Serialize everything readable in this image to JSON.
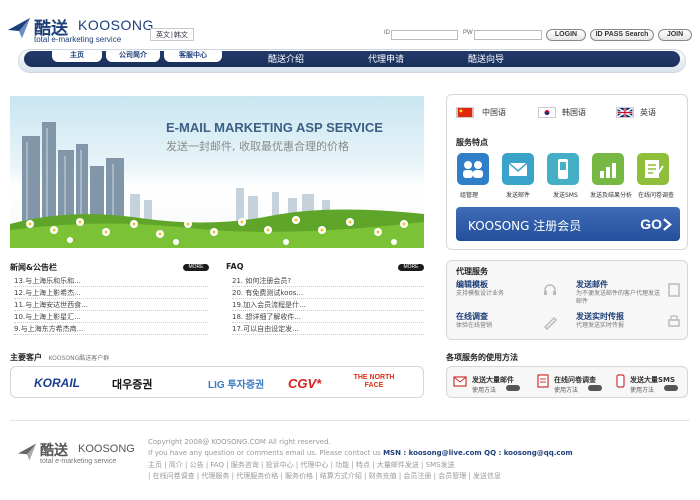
{
  "header": {
    "logo": {
      "cn": "酷送",
      "en": "KOOSONG",
      "tagline": "total e-marketing service"
    },
    "lang_links": [
      "英文",
      "韩文"
    ],
    "login": {
      "id_label": "ID",
      "pw_label": "PW",
      "login_button": "LOGIN",
      "idpass_button": "ID PASS Search",
      "join_button": "JOIN"
    }
  },
  "nav": {
    "sub_items": [
      "主页",
      "公司简介",
      "客服中心"
    ],
    "main_items": [
      "酷送介绍",
      "代理申请",
      "酷送向导"
    ]
  },
  "banner": {
    "title": "E-MAIL MARKETING ASP SERVICE",
    "subtitle": "发送一封邮件, 收取最优惠合理的价格"
  },
  "languages": [
    {
      "label": "中国语",
      "flag": "china-flag-icon"
    },
    {
      "label": "韩国语",
      "flag": "korea-flag-icon"
    },
    {
      "label": "英语",
      "flag": "uk-flag-icon"
    }
  ],
  "features": {
    "title": "服务特点",
    "items": [
      {
        "label": "组管理",
        "icon": "group-icon",
        "color": "#2f7fc8"
      },
      {
        "label": "发送邮件",
        "icon": "mail-icon",
        "color": "#3aa3c9"
      },
      {
        "label": "发送SMS",
        "icon": "phone-icon",
        "color": "#45b0c5"
      },
      {
        "label": "发送及结果分析",
        "icon": "chart-icon",
        "color": "#76b843"
      },
      {
        "label": "在线问卷调查",
        "icon": "survey-icon",
        "color": "#8fbe3a"
      }
    ]
  },
  "register": {
    "label": "KOOSONG 注册会员",
    "go": "GO"
  },
  "agent_services": {
    "title": "代理服务",
    "items": [
      {
        "title": "编辑模板",
        "desc": "支持模板设计业务"
      },
      {
        "title": "发送邮件",
        "desc": "为不便发送邮件的客户代理发送邮件"
      },
      {
        "title": "在线调查",
        "desc": "体验在线营销"
      },
      {
        "title": "发送实时传报",
        "desc": "代理发送实时传报"
      }
    ]
  },
  "usage": {
    "title": "各项服务的使用方法",
    "items": [
      {
        "title": "发送大量邮件",
        "sub": "使用方法"
      },
      {
        "title": "在线问卷调查",
        "sub": "使用方法"
      },
      {
        "title": "发送大量SMS",
        "sub": "使用方法"
      }
    ]
  },
  "news": {
    "title": "新闻&公告栏",
    "more": "MORE",
    "items": [
      "13.与上海乐和乐和...",
      "12.与上海上影希杰...",
      "11.与上海安达世西食...",
      "10.与上海上影星汇...",
      "9.与上海东方希杰商..."
    ]
  },
  "faq": {
    "title": "FAQ",
    "more": "MORE",
    "items": [
      "21. 如何注册会员?",
      "20. 有免费测试koos...",
      "19.加入会员流程是什...",
      "18. 想详细了解收件...",
      "17.可以自由设定发..."
    ]
  },
  "clients": {
    "title": "主要客户",
    "subtitle": "KOOSONG酷送客户群",
    "logos": [
      {
        "text": "KORAIL",
        "color": "#1a3f8f"
      },
      {
        "text": "대우증권",
        "color": "#111111"
      },
      {
        "text": "LIG 투자증권",
        "color": "#3b7ac4"
      },
      {
        "text": "CGV*",
        "color": "#d62020"
      },
      {
        "text": "THE NORTH FACE",
        "color": "#e03010"
      }
    ]
  },
  "footer": {
    "logo": {
      "cn": "酷送",
      "en": "KOOSONG",
      "tagline": "total e-marketing service"
    },
    "copyright": "Copyright 2008@ KOOSONG.COM All right reserved.",
    "contact_prefix": "If you have any question or comments email us. Please contact us",
    "contact_strong": "MSN : koosong@live.com QQ : koosong@qq.com",
    "links_row1": "主页 | 简介 | 公告 | FAQ | 服务咨询 | 投诉中心 | 代理中心 | 功能 | 特点 | 大量邮件发送 | SMS发送",
    "links_row2": "| 在线问卷调查 | 代理服务 | 代理服务价格 | 服务价格 | 结算方式介绍 | 财务充值 | 会员注册 | 会员管理 | 发送信息"
  }
}
